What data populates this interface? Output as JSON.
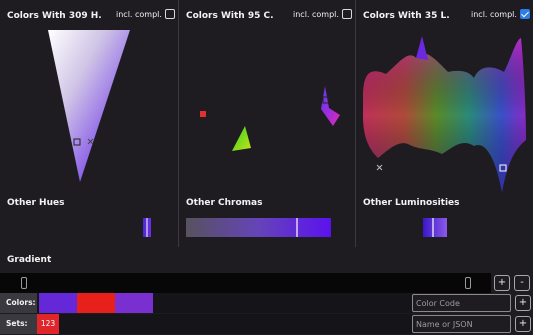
{
  "panels": [
    {
      "title": "Colors With 309 H.",
      "compl_label": "incl. compl.",
      "compl_checked": false,
      "other_label": "Other Hues"
    },
    {
      "title": "Colors With 95 C.",
      "compl_label": "incl. compl.",
      "compl_checked": false,
      "other_label": "Other Chromas"
    },
    {
      "title": "Colors With 35 L.",
      "compl_label": "incl. compl.",
      "compl_checked": true,
      "other_label": "Other Luminosities"
    }
  ],
  "gradient": {
    "title": "Gradient",
    "add_label": "+",
    "remove_label": "-"
  },
  "colors_row": {
    "label": "Colors:",
    "swatches": [
      "#6428d9",
      "#e8201c",
      "#7a2fd0"
    ],
    "input_placeholder": "Color Code",
    "add_label": "+"
  },
  "sets_row": {
    "label": "Sets:",
    "set_value": "123",
    "set_color": "#e0262a",
    "input_placeholder": "Name or JSON",
    "add_label": "+"
  }
}
